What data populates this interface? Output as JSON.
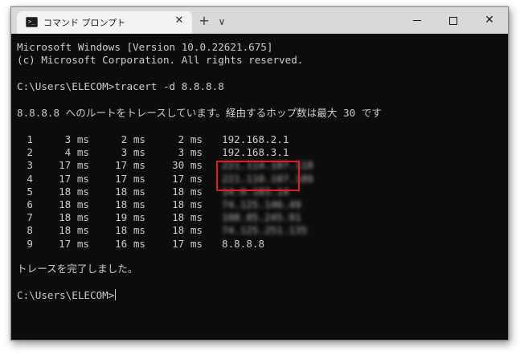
{
  "window": {
    "tab_title": "コマンド プロンプト",
    "tab_close_glyph": "✕",
    "new_tab_glyph": "+",
    "dropdown_glyph": "∨",
    "close_glyph": "✕"
  },
  "console": {
    "banner_line1": "Microsoft Windows [Version 10.0.22621.675]",
    "banner_line2": "(c) Microsoft Corporation. All rights reserved.",
    "command_line": "C:\\Users\\ELECOM>tracert -d 8.8.8.8",
    "route_header": "8.8.8.8 へのルートをトレースしています。経由するホップ数は最大 30 です",
    "hops": [
      {
        "n": "1",
        "t1": "3 ms",
        "t2": "2 ms",
        "t3": "2 ms",
        "ip": "192.168.2.1",
        "blurred": false
      },
      {
        "n": "2",
        "t1": "4 ms",
        "t2": "3 ms",
        "t3": "3 ms",
        "ip": "192.168.3.1",
        "blurred": false
      },
      {
        "n": "3",
        "t1": "17 ms",
        "t2": "17 ms",
        "t3": "30 ms",
        "ip": "221.114.107.118",
        "blurred": true
      },
      {
        "n": "4",
        "t1": "17 ms",
        "t2": "17 ms",
        "t3": "17 ms",
        "ip": "221.110.107.189",
        "blurred": true
      },
      {
        "n": "5",
        "t1": "18 ms",
        "t2": "18 ms",
        "t3": "18 ms",
        "ip": "14.0.183.14",
        "blurred": true
      },
      {
        "n": "6",
        "t1": "18 ms",
        "t2": "18 ms",
        "t3": "18 ms",
        "ip": "74.125.146.49",
        "blurred": true
      },
      {
        "n": "7",
        "t1": "18 ms",
        "t2": "19 ms",
        "t3": "18 ms",
        "ip": "108.85.245.91",
        "blurred": true
      },
      {
        "n": "8",
        "t1": "18 ms",
        "t2": "18 ms",
        "t3": "18 ms",
        "ip": "74.125.251.135",
        "blurred": true
      },
      {
        "n": "9",
        "t1": "17 ms",
        "t2": "16 ms",
        "t3": "17 ms",
        "ip": "8.8.8.8",
        "blurred": false
      }
    ],
    "complete_line": "トレースを完了しました。",
    "prompt": "C:\\Users\\ELECOM>"
  },
  "colors": {
    "highlight": "#e21b23",
    "console_bg": "#0c0c0c",
    "console_text": "#cccccc"
  }
}
